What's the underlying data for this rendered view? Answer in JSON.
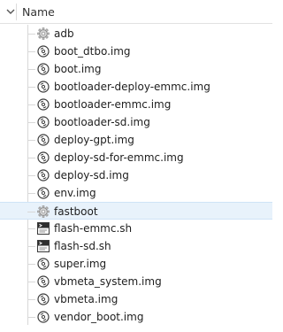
{
  "header": {
    "column_label": "Name"
  },
  "files": [
    {
      "name": "adb",
      "icon": "gear-exec-icon",
      "selected": false
    },
    {
      "name": "boot_dtbo.img",
      "icon": "disk-image-icon",
      "selected": false
    },
    {
      "name": "boot.img",
      "icon": "disk-image-icon",
      "selected": false
    },
    {
      "name": "bootloader-deploy-emmc.img",
      "icon": "disk-image-icon",
      "selected": false
    },
    {
      "name": "bootloader-emmc.img",
      "icon": "disk-image-icon",
      "selected": false
    },
    {
      "name": "bootloader-sd.img",
      "icon": "disk-image-icon",
      "selected": false
    },
    {
      "name": "deploy-gpt.img",
      "icon": "disk-image-icon",
      "selected": false
    },
    {
      "name": "deploy-sd-for-emmc.img",
      "icon": "disk-image-icon",
      "selected": false
    },
    {
      "name": "deploy-sd.img",
      "icon": "disk-image-icon",
      "selected": false
    },
    {
      "name": "env.img",
      "icon": "disk-image-icon",
      "selected": false
    },
    {
      "name": "fastboot",
      "icon": "gear-exec-icon",
      "selected": true
    },
    {
      "name": "flash-emmc.sh",
      "icon": "shell-script-icon",
      "selected": false
    },
    {
      "name": "flash-sd.sh",
      "icon": "shell-script-icon",
      "selected": false
    },
    {
      "name": "super.img",
      "icon": "disk-image-icon",
      "selected": false
    },
    {
      "name": "vbmeta_system.img",
      "icon": "disk-image-icon",
      "selected": false
    },
    {
      "name": "vbmeta.img",
      "icon": "disk-image-icon",
      "selected": false
    },
    {
      "name": "vendor_boot.img",
      "icon": "disk-image-icon",
      "selected": false
    }
  ],
  "colors": {
    "selection_bg": "#e8f2fb",
    "tree_line": "#d8d8d8"
  }
}
